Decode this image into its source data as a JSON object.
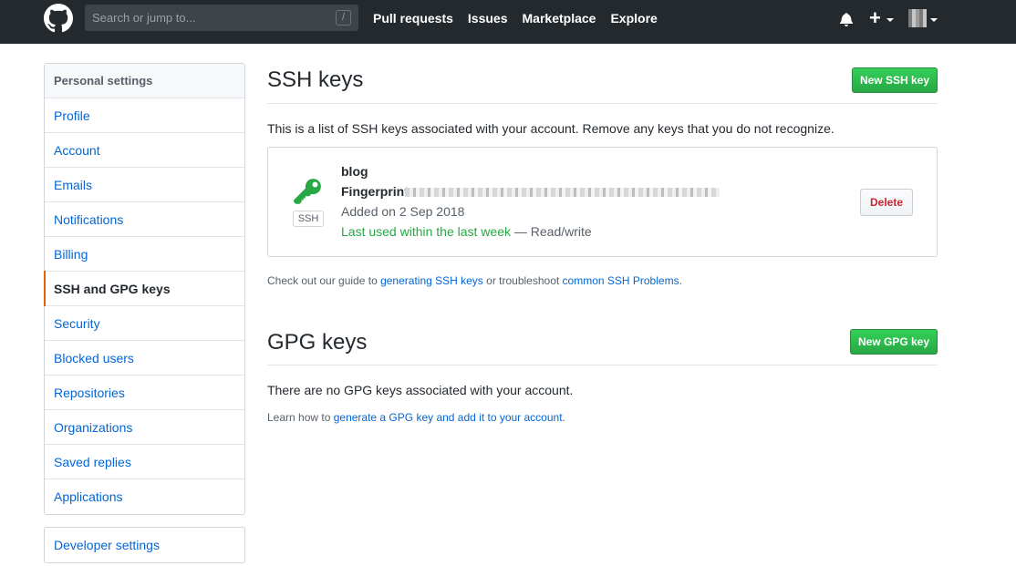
{
  "header": {
    "search_placeholder": "Search or jump to...",
    "search_shortcut": "/",
    "nav": [
      "Pull requests",
      "Issues",
      "Marketplace",
      "Explore"
    ],
    "plus_label": "+"
  },
  "sidebar": {
    "heading": "Personal settings",
    "items": [
      {
        "label": "Profile"
      },
      {
        "label": "Account"
      },
      {
        "label": "Emails"
      },
      {
        "label": "Notifications"
      },
      {
        "label": "Billing"
      },
      {
        "label": "SSH and GPG keys",
        "selected": true
      },
      {
        "label": "Security"
      },
      {
        "label": "Blocked users"
      },
      {
        "label": "Repositories"
      },
      {
        "label": "Organizations"
      },
      {
        "label": "Saved replies"
      },
      {
        "label": "Applications"
      }
    ],
    "developer_settings": "Developer settings"
  },
  "ssh": {
    "title": "SSH keys",
    "new_button": "New SSH key",
    "description": "This is a list of SSH keys associated with your account. Remove any keys that you do not recognize.",
    "key": {
      "name": "blog",
      "fingerprint_label": "Fingerprint",
      "tag": "SSH",
      "added": "Added on 2 Sep 2018",
      "last_used": "Last used within the last week",
      "access": " — Read/write",
      "delete": "Delete"
    },
    "guide_prefix": "Check out our guide to ",
    "guide_link": "generating SSH keys",
    "guide_middle": " or troubleshoot ",
    "guide_link2": "common SSH Problems",
    "guide_suffix": "."
  },
  "gpg": {
    "title": "GPG keys",
    "new_button": "New GPG key",
    "empty": "There are no GPG keys associated with your account.",
    "learn_prefix": "Learn how to ",
    "learn_link": "generate a GPG key and add it to your account",
    "learn_suffix": "."
  },
  "colors": {
    "header_bg": "#24292e",
    "link": "#0366d6",
    "green": "#28a745",
    "danger": "#cb2431",
    "selected_accent": "#e36209"
  }
}
